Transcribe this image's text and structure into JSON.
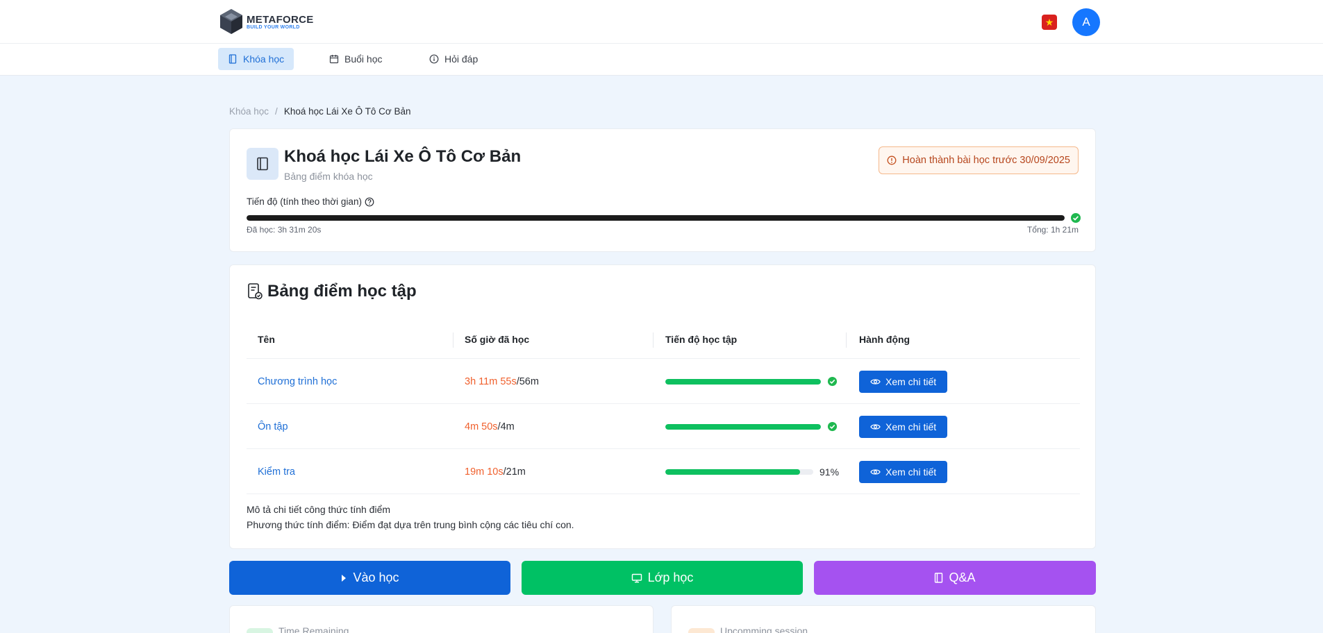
{
  "brand": {
    "name": "METAFORCE",
    "tagline": "BUILD YOUR WORLD"
  },
  "header": {
    "flag_icon": "vietnam-flag-icon",
    "avatar_initial": "A"
  },
  "nav": {
    "tabs": [
      {
        "label": "Khóa học",
        "icon": "book-icon",
        "active": true
      },
      {
        "label": "Buổi học",
        "icon": "calendar-icon",
        "active": false
      },
      {
        "label": "Hỏi đáp",
        "icon": "info-icon",
        "active": false
      }
    ]
  },
  "breadcrumb": {
    "root": "Khóa học",
    "separator": "/",
    "current": "Khoá học Lái Xe Ô Tô Cơ Bản"
  },
  "course": {
    "title": "Khoá học Lái Xe Ô Tô Cơ Bản",
    "subtitle": "Bảng điểm khóa học",
    "deadline": "Hoàn thành bài học trước 30/09/2025",
    "progress_label": "Tiến độ (tính theo thời gian)",
    "progress_percent": 100,
    "studied": "Đã học: 3h 31m 20s",
    "total": "Tổng: 1h 21m"
  },
  "scoreboard": {
    "title": "Bảng điểm học tập",
    "columns": [
      "Tên",
      "Số giờ đã học",
      "Tiến độ học tập",
      "Hành động"
    ],
    "rows": [
      {
        "name": "Chương trình học",
        "done": "3h 11m 55s",
        "total": "/56m",
        "percent": 100,
        "complete": true,
        "action": "Xem chi tiết"
      },
      {
        "name": "Ôn tập",
        "done": "4m 50s",
        "total": "/4m",
        "percent": 100,
        "complete": true,
        "action": "Xem chi tiết"
      },
      {
        "name": "Kiểm tra",
        "done": "19m 10s",
        "total": "/21m",
        "percent": 91,
        "complete": false,
        "percent_label": "91%",
        "action": "Xem chi tiết"
      }
    ],
    "formula_title": "Mô tả chi tiết công thức tính điểm",
    "formula_desc": "Phương thức tính điểm: Điểm đạt dựa trên trung bình cộng các tiêu chí con."
  },
  "actions": {
    "learn": "Vào học",
    "classroom": "Lớp học",
    "qa": "Q&A"
  },
  "bottom": {
    "left_label": "Time Remaining",
    "right_label": "Upcomming session"
  },
  "colors": {
    "primary": "#0f63d8",
    "success": "#00c164",
    "purple": "#a552f0",
    "orange": "#f0602d"
  }
}
